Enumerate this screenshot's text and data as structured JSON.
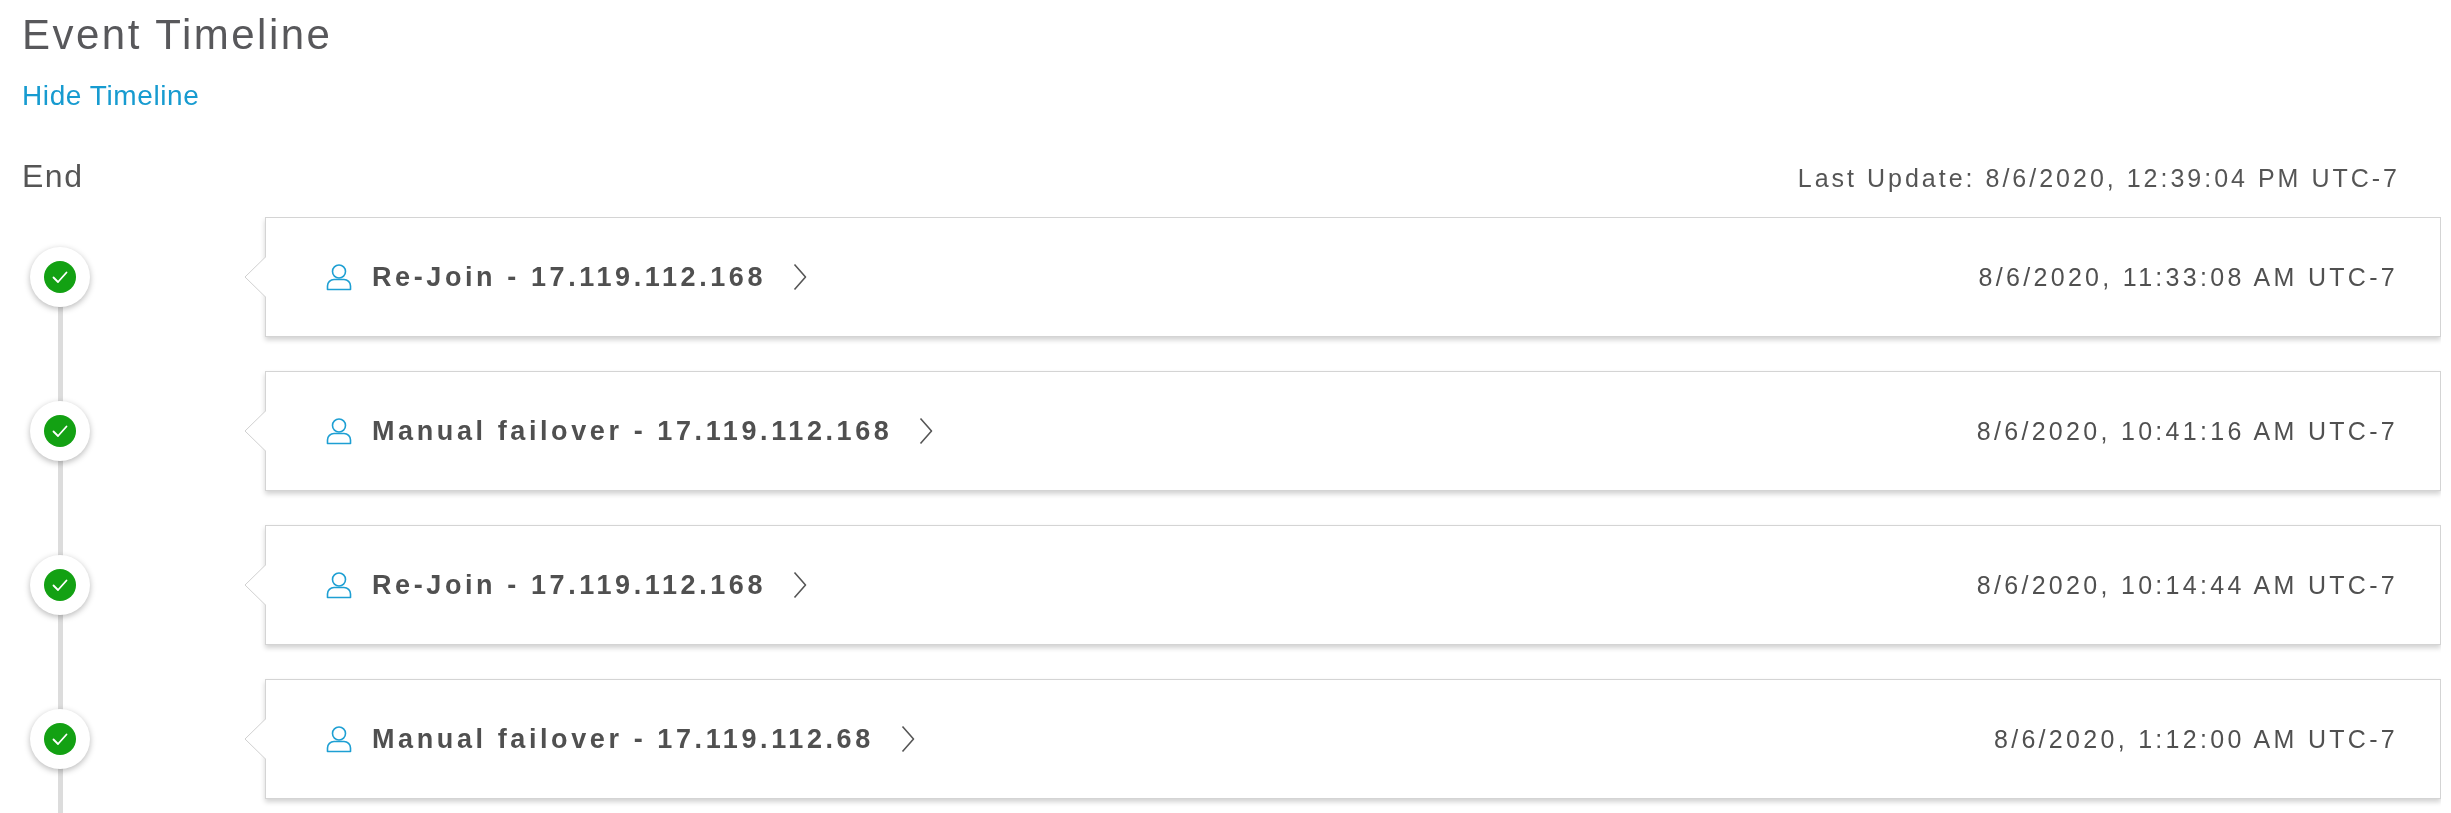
{
  "page_title": "Event Timeline",
  "toggle_link": "Hide Timeline",
  "timeline": {
    "end_label": "End",
    "last_update": "Last Update: 8/6/2020, 12:39:04 PM UTC-7",
    "events": [
      {
        "succeeded": true,
        "title": "Re-Join - 17.119.112.168",
        "timestamp": "8/6/2020, 11:33:08 AM UTC-7"
      },
      {
        "succeeded": true,
        "title": "Manual failover - 17.119.112.168",
        "timestamp": "8/6/2020, 10:41:16 AM UTC-7"
      },
      {
        "succeeded": true,
        "title": "Re-Join - 17.119.112.168",
        "timestamp": "8/6/2020, 10:14:44 AM UTC-7"
      },
      {
        "succeeded": true,
        "title": "Manual failover - 17.119.112.68",
        "timestamp": "8/6/2020, 1:12:00 AM UTC-7"
      }
    ]
  }
}
